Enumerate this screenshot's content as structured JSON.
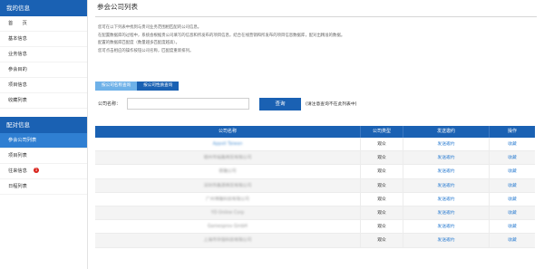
{
  "sidebar": {
    "section1_title": "我的信息",
    "section1_items": [
      {
        "label": "首　　页"
      },
      {
        "label": "基本信息"
      },
      {
        "label": "业务信息"
      },
      {
        "label": "参会目的"
      },
      {
        "label": "项目信息"
      },
      {
        "label": "收藏列表"
      }
    ],
    "section2_title": "配对信息",
    "section2_items": [
      {
        "label": "参会公司列表",
        "active": true
      },
      {
        "label": "项目列表"
      },
      {
        "label": "往来信息",
        "badge": "1"
      },
      {
        "label": "日程列表"
      }
    ]
  },
  "main": {
    "title": "参会公司列表",
    "desc": [
      "您可在以下列表中找到与贵司业务范围相匹配的公司信息。",
      "在配置数据库的过程中，系统会根据贵公司填写的信息和所发布的项目信息，结合在线营销和所发布的项目信息数据库，配对出精准的数据。",
      "配置的数据库匹配度（数量越多匹配度越高）。",
      "您可点击相应的操作按钮公司名称，匹配度重新排列。"
    ],
    "tabs": [
      "按公司名称查询",
      "按公司性质查询"
    ]
  },
  "search": {
    "label": "公司名称：",
    "value": "",
    "placeholder": "",
    "button": "查询",
    "hint": "(请注意查询不在此列表中)"
  },
  "table": {
    "headers": [
      "公司名称",
      "公司类型",
      "发送邀约",
      "操作"
    ],
    "rows": [
      {
        "name": "Appoli Taiwan",
        "type": "观众",
        "invite": "发送邀约",
        "action": "收藏"
      },
      {
        "name": "德州市福鑫商贸有限公司",
        "type": "观众",
        "invite": "发送邀约",
        "action": "收藏"
      },
      {
        "name": "德雅公司",
        "type": "观众",
        "invite": "发送邀约",
        "action": "收藏"
      },
      {
        "name": "深圳市鑫源商贸有限公司",
        "type": "观众",
        "invite": "发送邀约",
        "action": "收藏"
      },
      {
        "name": "广州博雅科技有限公司",
        "type": "观众",
        "invite": "发送邀约",
        "action": "收藏"
      },
      {
        "name": "YD Online Corp",
        "type": "观众",
        "invite": "发送邀约",
        "action": "收藏"
      },
      {
        "name": "Gamesprov GmbH",
        "type": "观众",
        "invite": "发送邀约",
        "action": "收藏"
      },
      {
        "name": "上海市华强科技有限公司",
        "type": "观众",
        "invite": "发送邀约",
        "action": "收藏"
      }
    ]
  },
  "colors": {
    "brand_blue": "#1a61b3",
    "active_blue": "#2f7fd2",
    "tab_light": "#6eb1e8",
    "badge_red": "#d9241c"
  }
}
